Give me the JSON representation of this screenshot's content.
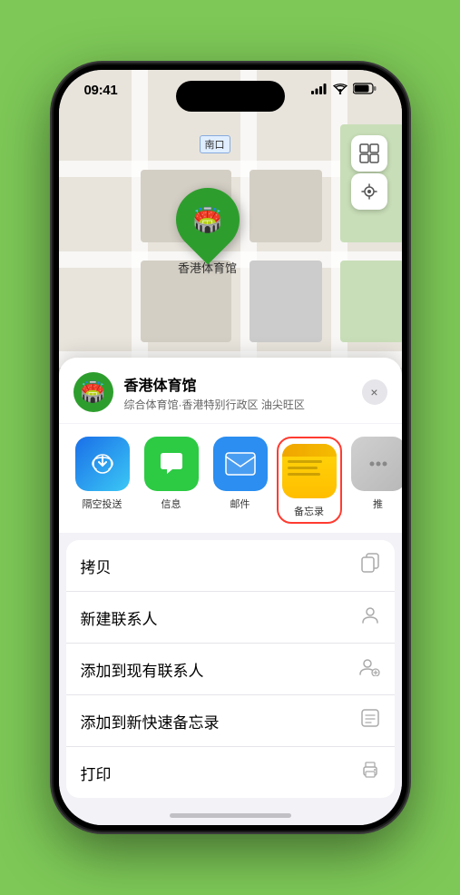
{
  "statusBar": {
    "time": "09:41",
    "location_arrow": true
  },
  "mapLabel": "南口",
  "venue": {
    "name": "香港体育馆",
    "description": "综合体育馆·香港特别行政区 油尖旺区",
    "pinLabel": "香港体育馆"
  },
  "shareItems": [
    {
      "id": "airdrop",
      "label": "隔空投送"
    },
    {
      "id": "messages",
      "label": "信息"
    },
    {
      "id": "mail",
      "label": "邮件"
    },
    {
      "id": "notes",
      "label": "备忘录"
    },
    {
      "id": "more",
      "label": "推"
    }
  ],
  "actionItems": [
    {
      "id": "copy",
      "label": "拷贝",
      "icon": "copy"
    },
    {
      "id": "new-contact",
      "label": "新建联系人",
      "icon": "person"
    },
    {
      "id": "add-existing",
      "label": "添加到现有联系人",
      "icon": "person-add"
    },
    {
      "id": "add-quick-note",
      "label": "添加到新快速备忘录",
      "icon": "quick-note"
    },
    {
      "id": "print",
      "label": "打印",
      "icon": "print"
    }
  ],
  "closeButton": "×"
}
